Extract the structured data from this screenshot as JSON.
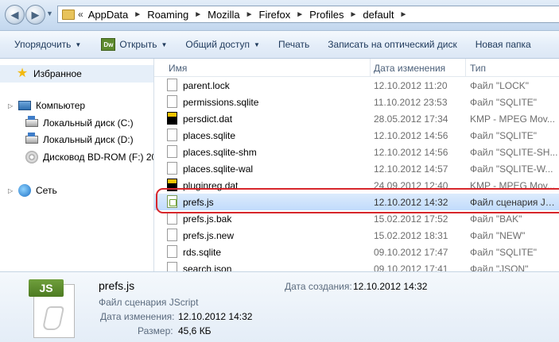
{
  "address": {
    "overflow": "«",
    "crumbs": [
      "AppData",
      "Roaming",
      "Mozilla",
      "Firefox",
      "Profiles",
      "default"
    ],
    "separator": "►"
  },
  "toolbar": {
    "organize": "Упорядочить",
    "open": "Открыть",
    "open_icon_text": "Dw",
    "share": "Общий доступ",
    "print": "Печать",
    "burn": "Записать на оптический диск",
    "new_folder": "Новая папка"
  },
  "nav": {
    "favorites": "Избранное",
    "computer": "Компьютер",
    "drive_c": "Локальный диск (C:)",
    "drive_d": "Локальный диск (D:)",
    "drive_f": "Дисковод BD-ROM (F:) 20",
    "network": "Сеть"
  },
  "columns": {
    "name": "Имя",
    "date": "Дата изменения",
    "type": "Тип"
  },
  "files": [
    {
      "name": "parent.lock",
      "date": "12.10.2012 11:20",
      "type": "Файл \"LOCK\"",
      "icon": "doc-icon"
    },
    {
      "name": "permissions.sqlite",
      "date": "11.10.2012 23:53",
      "type": "Файл \"SQLITE\"",
      "icon": "doc-icon"
    },
    {
      "name": "persdict.dat",
      "date": "28.05.2012 17:34",
      "type": "KMP - MPEG Mov...",
      "icon": "dat-icon"
    },
    {
      "name": "places.sqlite",
      "date": "12.10.2012 14:56",
      "type": "Файл \"SQLITE\"",
      "icon": "doc-icon"
    },
    {
      "name": "places.sqlite-shm",
      "date": "12.10.2012 14:56",
      "type": "Файл \"SQLITE-SH...",
      "icon": "doc-icon"
    },
    {
      "name": "places.sqlite-wal",
      "date": "12.10.2012 14:57",
      "type": "Файл \"SQLITE-W...",
      "icon": "doc-icon"
    },
    {
      "name": "pluginreg.dat",
      "date": "24.09.2012 12:40",
      "type": "KMP - MPEG Mov...",
      "icon": "dat-icon"
    },
    {
      "name": "prefs.js",
      "date": "12.10.2012 14:32",
      "type": "Файл сценария JS...",
      "icon": "js-icon"
    },
    {
      "name": "prefs.js.bak",
      "date": "15.02.2012 17:52",
      "type": "Файл \"BAK\"",
      "icon": "doc-icon"
    },
    {
      "name": "prefs.js.new",
      "date": "15.02.2012 18:31",
      "type": "Файл \"NEW\"",
      "icon": "doc-icon"
    },
    {
      "name": "rds.sqlite",
      "date": "09.10.2012 17:47",
      "type": "Файл \"SQLITE\"",
      "icon": "doc-icon"
    },
    {
      "name": "search.json",
      "date": "09.10.2012 17:41",
      "type": "Файл \"JSON\"",
      "icon": "doc-icon"
    }
  ],
  "details": {
    "icon_badge": "JS",
    "name": "prefs.js",
    "type": "Файл сценария JScript",
    "modified_label": "Дата изменения:",
    "modified_value": "12.10.2012 14:32",
    "size_label": "Размер:",
    "size_value": "45,6 КБ",
    "created_label": "Дата создания:",
    "created_value": "12.10.2012 14:32"
  }
}
